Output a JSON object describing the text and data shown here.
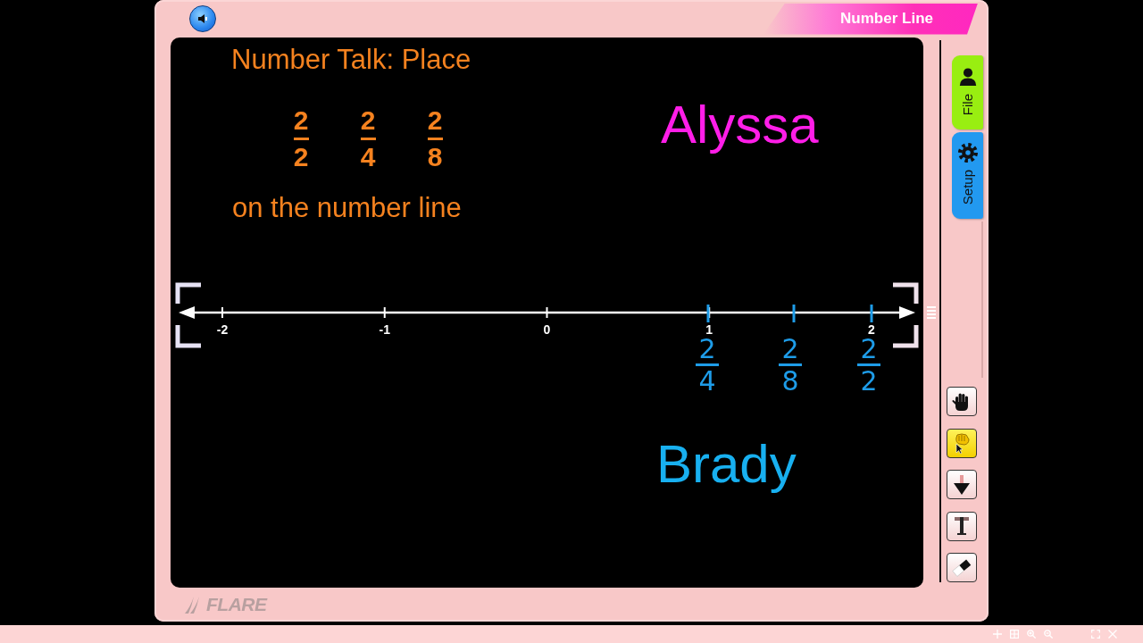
{
  "window": {
    "title": "Number Line",
    "brand": "FLARE"
  },
  "canvas": {
    "heading": "Number Talk: Place",
    "fractions": [
      {
        "numerator": "2",
        "denominator": "2"
      },
      {
        "numerator": "2",
        "denominator": "4"
      },
      {
        "numerator": "2",
        "denominator": "8"
      }
    ],
    "caption": "on the number line",
    "names": [
      {
        "text": "Alyssa",
        "color": "#ff1ee8"
      },
      {
        "text": "Brady",
        "color": "#18b0f0"
      }
    ],
    "number_line": {
      "ticks": [
        "-2",
        "-1",
        "0",
        "1",
        "2"
      ],
      "marks": [
        {
          "numerator": "2",
          "denominator": "4"
        },
        {
          "numerator": "2",
          "denominator": "8"
        },
        {
          "numerator": "2",
          "denominator": "2"
        }
      ]
    }
  },
  "side_tabs": [
    {
      "label": "File",
      "kind": "person",
      "color": "#99ee11"
    },
    {
      "label": "Setup",
      "kind": "gear",
      "color": "#2299f0"
    }
  ],
  "tools": [
    {
      "kind": "hand",
      "selected": false
    },
    {
      "kind": "pointer",
      "selected": true
    },
    {
      "kind": "arrow",
      "selected": false
    },
    {
      "kind": "text",
      "selected": false
    },
    {
      "kind": "eraser",
      "selected": false
    }
  ],
  "player_controls": [
    {
      "kind": "plus"
    },
    {
      "kind": "grid"
    },
    {
      "kind": "zoom_in"
    },
    {
      "kind": "zoom_out"
    },
    {
      "kind": "fullscreen"
    },
    {
      "kind": "close"
    }
  ]
}
